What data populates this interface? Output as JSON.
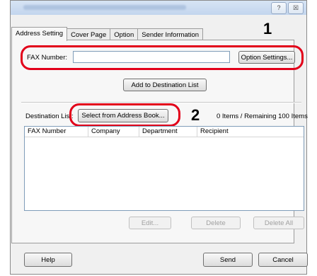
{
  "window": {
    "buttons": {
      "help_icon": "?",
      "close_icon": "☒"
    }
  },
  "tabs": [
    "Address Setting",
    "Cover Page",
    "Option",
    "Sender Information"
  ],
  "fax": {
    "label": "FAX Number:",
    "value": "",
    "option_button": "Option Settings..."
  },
  "add_button": "Add to Destination List",
  "destination": {
    "label": "Destination List:",
    "select_button": "Select from Address Book...",
    "count_text": "0 Items / Remaining 100 Items"
  },
  "list": {
    "columns": [
      "FAX Number",
      "Company",
      "Department",
      "Recipient"
    ]
  },
  "list_buttons": {
    "edit": "Edit...",
    "delete": "Delete",
    "delete_all": "Delete All"
  },
  "footer": {
    "help": "Help",
    "send": "Send",
    "cancel": "Cancel"
  },
  "callouts": {
    "one": "1",
    "two": "2",
    "color": "#e2001a"
  }
}
